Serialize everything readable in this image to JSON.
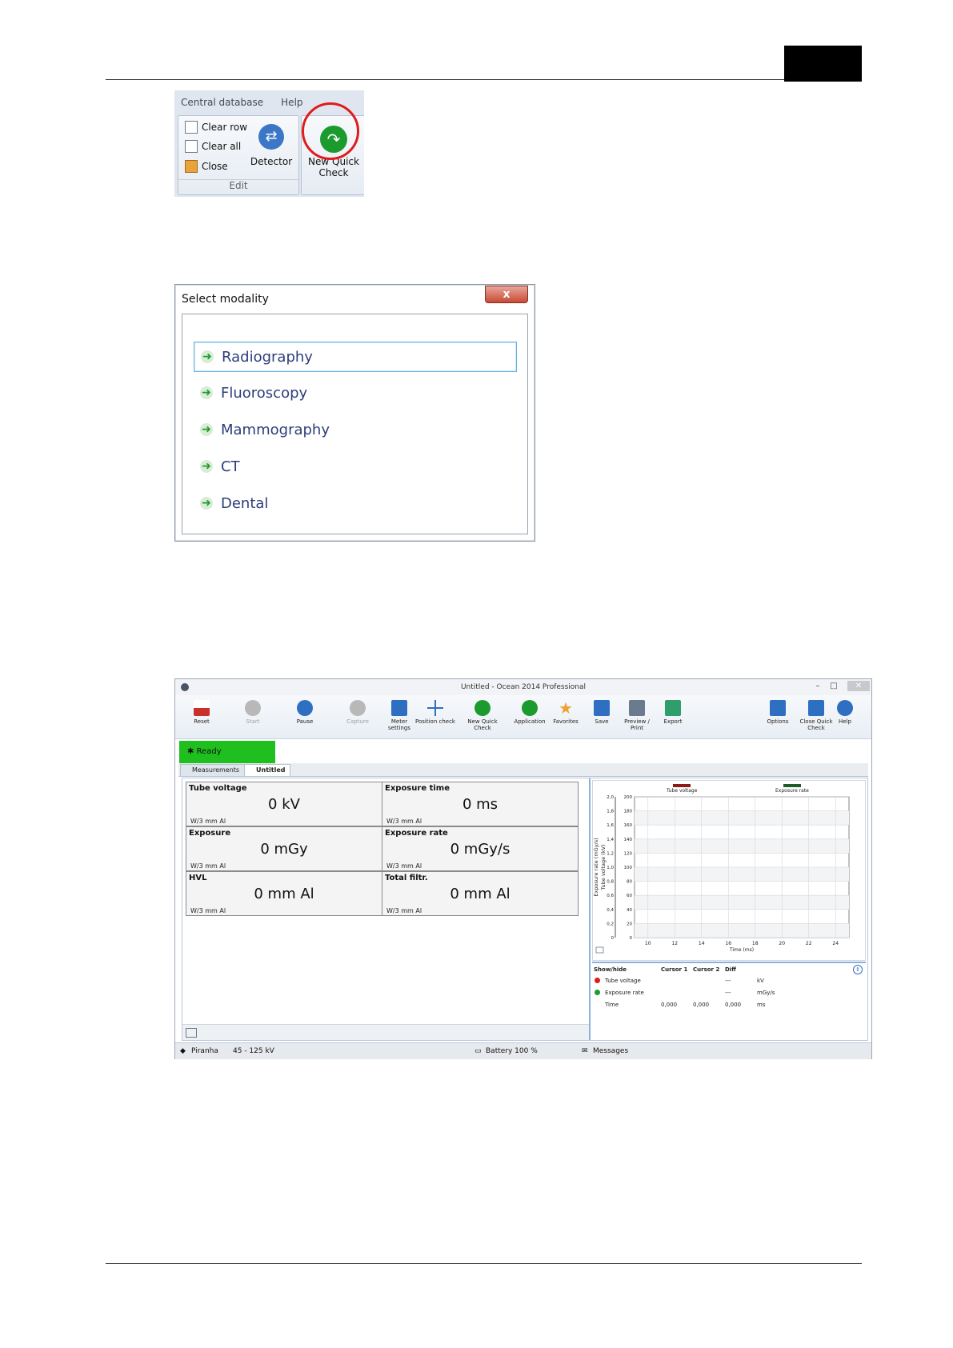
{
  "ribbon": {
    "menu": [
      "Central database",
      "Help"
    ],
    "edit_items": [
      "Clear row",
      "Clear all",
      "Close"
    ],
    "detector_label": "Detector",
    "edit_group_label": "Edit",
    "new_quick_check_label_1": "New Quick",
    "new_quick_check_label_2": "Check"
  },
  "dialog": {
    "title": "Select modality",
    "close_symbol": "x",
    "items": [
      "Radiography",
      "Fluoroscopy",
      "Mammography",
      "CT",
      "Dental"
    ]
  },
  "app": {
    "title": "Untitled - Ocean 2014 Professional",
    "toolbar": [
      {
        "label": "Reset",
        "color": "#c9302c"
      },
      {
        "label": "Start",
        "color": "#b8b8b8"
      },
      {
        "label": "Pause",
        "color": "#2f6fc1"
      },
      {
        "label": "Capture",
        "color": "#b8b8b8"
      },
      {
        "label": "Meter settings",
        "color": "#2f6fc1"
      },
      {
        "label": "Position check",
        "color": "#2f6fc1"
      },
      {
        "label": "New Quick Check",
        "color": "#1b9b2e"
      },
      {
        "label": "Application",
        "color": "#1b9b2e"
      },
      {
        "label": "Favorites",
        "color": "#f0a030"
      },
      {
        "label": "Save",
        "color": "#2f6fc1"
      },
      {
        "label": "Preview / Print",
        "color": "#6b7b8e"
      },
      {
        "label": "Export",
        "color": "#2f9e6a"
      },
      {
        "label": "Options",
        "color": "#2f6fc1"
      },
      {
        "label": "Close Quick Check",
        "color": "#2f6fc1"
      },
      {
        "label": "Help",
        "color": "#2f6fc1"
      }
    ],
    "status": "Ready",
    "tabs": [
      "Measurements",
      "Untitled"
    ],
    "measurements": [
      {
        "label": "Tube voltage",
        "value": "0 kV",
        "unit": "W/3 mm Al"
      },
      {
        "label": "Exposure time",
        "value": "0 ms",
        "unit": "W/3 mm Al"
      },
      {
        "label": "Exposure",
        "value": "0 mGy",
        "unit": "W/3 mm Al"
      },
      {
        "label": "Exposure rate",
        "value": "0 mGy/s",
        "unit": "W/3 mm Al"
      },
      {
        "label": "HVL",
        "value": "0 mm Al",
        "unit": "W/3 mm Al"
      },
      {
        "label": "Total filtr.",
        "value": "0 mm Al",
        "unit": "W/3 mm Al"
      }
    ],
    "cursor_table": {
      "headers": [
        "Show/hide",
        "Cursor 1",
        "Cursor 2",
        "Diff"
      ],
      "rows": [
        {
          "name": "Tube voltage",
          "c1": "",
          "c2": "",
          "diff": "---",
          "unit": "kV",
          "color": "#e01b1b"
        },
        {
          "name": "Exposure rate",
          "c1": "",
          "c2": "",
          "diff": "---",
          "unit": "mGy/s",
          "color": "#1b9b2e"
        },
        {
          "name": "Time",
          "c1": "0,000",
          "c2": "0,000",
          "diff": "0,000",
          "unit": "ms",
          "color": ""
        }
      ]
    },
    "statusbar": {
      "detector": "Piranha",
      "range": "45 - 125 kV",
      "battery": "Battery 100 %",
      "messages": "Messages"
    }
  },
  "chart_data": {
    "type": "line",
    "series": [
      {
        "name": "Tube voltage",
        "color": "#8b1a1a",
        "values": []
      },
      {
        "name": "Exposure rate",
        "color": "#1e5c2a",
        "values": []
      }
    ],
    "xlabel": "Time (ms)",
    "ylabel_left": "Exposure rate (mGy/s)",
    "ylabel_right": "Tube voltage (kV)",
    "x_ticks": [
      10,
      12,
      14,
      16,
      18,
      20,
      22,
      24
    ],
    "xlim": [
      9,
      25
    ],
    "y_left_ticks": [
      "0",
      "0,2",
      "0,4",
      "0,6",
      "0,8",
      "1,0",
      "1,2",
      "1,4",
      "1,6",
      "1,8",
      "2,0"
    ],
    "y_right_ticks": [
      0,
      20,
      40,
      60,
      80,
      100,
      120,
      140,
      160,
      180,
      200
    ],
    "ylim_right": [
      0,
      200
    ],
    "grid": true
  }
}
